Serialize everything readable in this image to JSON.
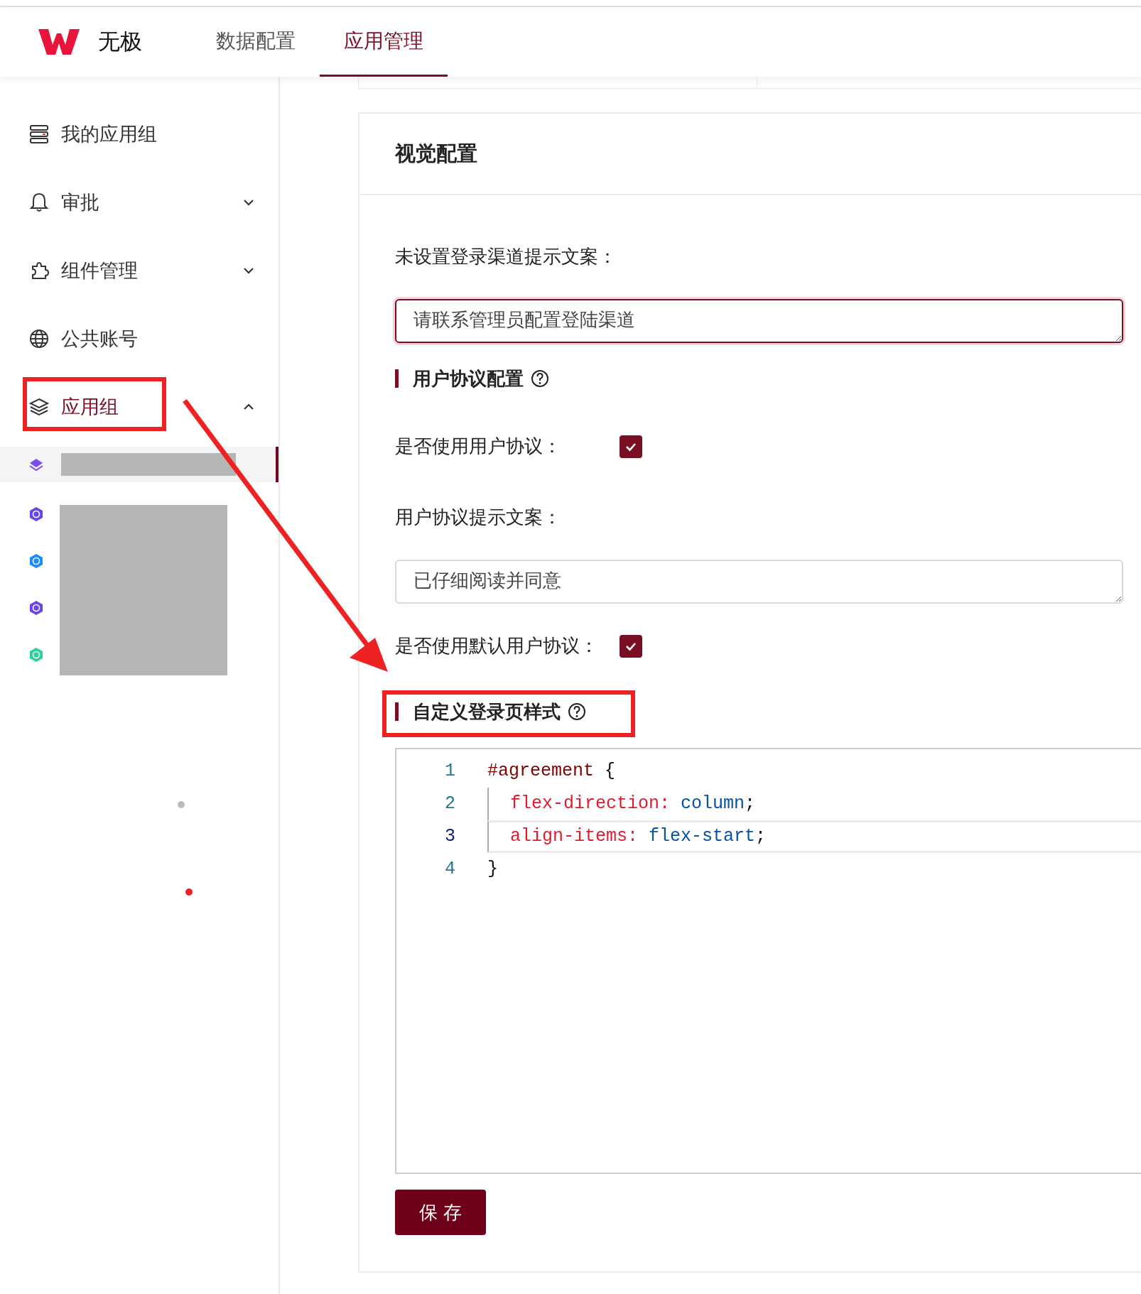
{
  "header": {
    "brand": "无极",
    "tabs": [
      {
        "label": "数据配置",
        "selected": false
      },
      {
        "label": "应用管理",
        "selected": true
      }
    ]
  },
  "sidebar": {
    "items": [
      {
        "label": "我的应用组",
        "kind": "link",
        "selected": false
      },
      {
        "label": "审批",
        "kind": "submenu",
        "expanded": false,
        "selected": false
      },
      {
        "label": "组件管理",
        "kind": "submenu",
        "expanded": false,
        "selected": false
      },
      {
        "label": "公共账号",
        "kind": "link",
        "selected": false
      },
      {
        "label": "应用组",
        "kind": "submenu",
        "expanded": true,
        "selected": true
      }
    ],
    "sub_items": [
      {
        "kind": "layers",
        "color": "#7b4cf0",
        "selected": true
      },
      {
        "kind": "hexagon",
        "color": "#6a45e8",
        "selected": false
      },
      {
        "kind": "hexagon",
        "color": "#1a8cff",
        "selected": false
      },
      {
        "kind": "hexagon",
        "color": "#6a45e8",
        "selected": false
      },
      {
        "kind": "hexagon",
        "color": "#2ecf9b",
        "selected": false
      }
    ]
  },
  "card": {
    "title": "视觉配置",
    "fields": [
      {
        "kind": "textarea",
        "label": "未设置登录渠道提示文案：",
        "value": "请联系管理员配置登陆渠道",
        "focused": true
      },
      {
        "kind": "section",
        "label": "用户协议配置"
      },
      {
        "kind": "checkbox",
        "label": "是否使用用户协议：",
        "checked": true
      },
      {
        "kind": "textarea",
        "label": "用户协议提示文案：",
        "value": "已仔细阅读并同意",
        "focused": false
      },
      {
        "kind": "checkbox",
        "label": "是否使用默认用户协议：",
        "checked": true
      },
      {
        "kind": "section",
        "label": "自定义登录页样式"
      }
    ],
    "code_lines": [
      {
        "number": "1",
        "indented": false,
        "active": false,
        "tokens": [
          {
            "kind": "selector",
            "text": "#agreement"
          },
          {
            "kind": "punct",
            "text": " {"
          }
        ]
      },
      {
        "number": "2",
        "indented": true,
        "active": false,
        "tokens": [
          {
            "kind": "property",
            "text": "flex-direction:"
          },
          {
            "kind": "value",
            "text": " column"
          },
          {
            "kind": "punct",
            "text": ";"
          }
        ]
      },
      {
        "number": "3",
        "indented": true,
        "active": true,
        "tokens": [
          {
            "kind": "property",
            "text": "align-items:"
          },
          {
            "kind": "value",
            "text": " flex-start"
          },
          {
            "kind": "punct",
            "text": ";"
          }
        ]
      },
      {
        "number": "4",
        "indented": false,
        "active": false,
        "tokens": [
          {
            "kind": "punct",
            "text": "}"
          }
        ]
      }
    ],
    "save_button": "保 存"
  }
}
